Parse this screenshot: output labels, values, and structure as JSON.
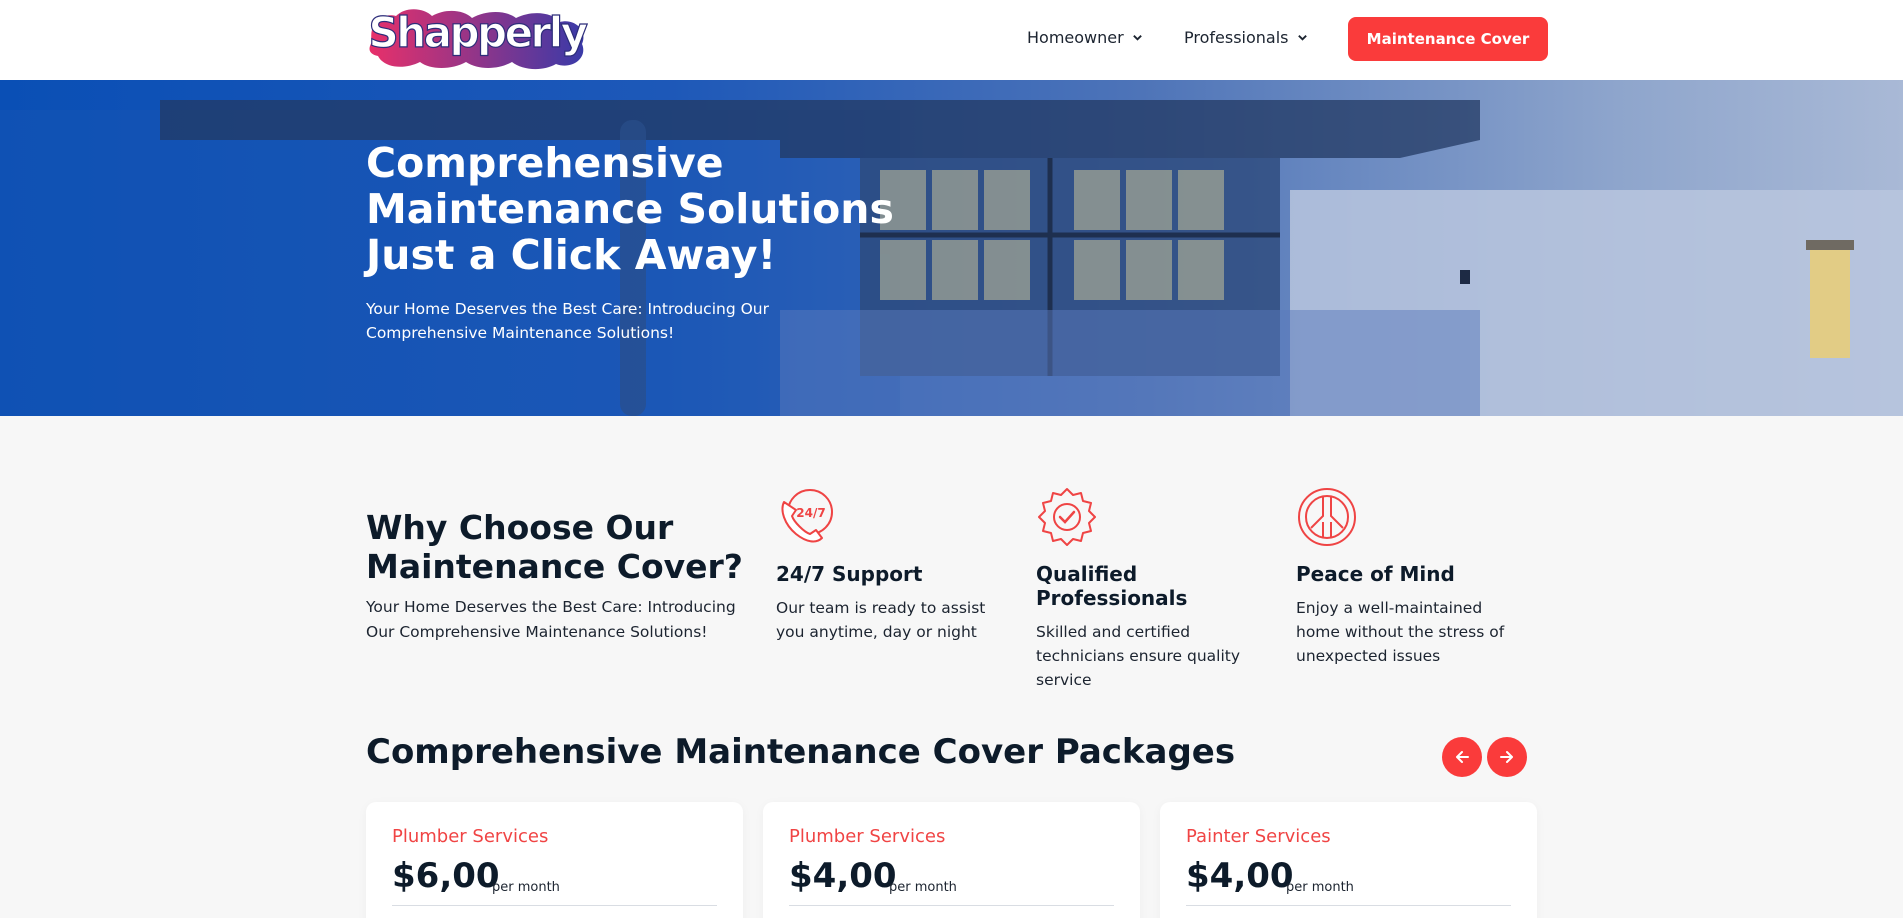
{
  "header": {
    "logo_text": "Shapperly",
    "nav": [
      {
        "label": "Homeowner"
      },
      {
        "label": "Professionals"
      }
    ],
    "cta_label": "Maintenance Cover",
    "colors": {
      "accent": "#fa3b3b",
      "logo_pink": "#e8306a",
      "logo_blue": "#3a3aa8"
    }
  },
  "hero": {
    "title": "Comprehensive Maintenance Solutions Just a Click Away!",
    "subtitle": "Your Home Deserves the Best Care: Introducing Our Comprehensive Maintenance Solutions!"
  },
  "why": {
    "title": "Why Choose Our Maintenance Cover?",
    "subtitle": "Your Home Deserves the Best Care: Introducing Our Comprehensive Maintenance Solutions!",
    "features": [
      {
        "icon": "phone-24-7-icon",
        "icon_text": "24/7",
        "title": "24/7 Support",
        "text": "Our team is ready to assist you anytime, day or night"
      },
      {
        "icon": "badge-check-icon",
        "title": "Qualified Professionals",
        "text": "Skilled and certified technicians ensure quality service"
      },
      {
        "icon": "peace-icon",
        "title": "Peace of Mind",
        "text": "Enjoy a well-maintained home without the stress of unexpected issues"
      }
    ]
  },
  "packages": {
    "title": "Comprehensive Maintenance Cover Packages",
    "prev_icon": "arrow-left-icon",
    "next_icon": "arrow-right-icon",
    "cards": [
      {
        "service": "Plumber Services",
        "price": "$6,00",
        "period": "per month"
      },
      {
        "service": "Plumber Services",
        "price": "$4,00",
        "period": "per month"
      },
      {
        "service": "Painter Services",
        "price": "$4,00",
        "period": "per month"
      }
    ]
  }
}
